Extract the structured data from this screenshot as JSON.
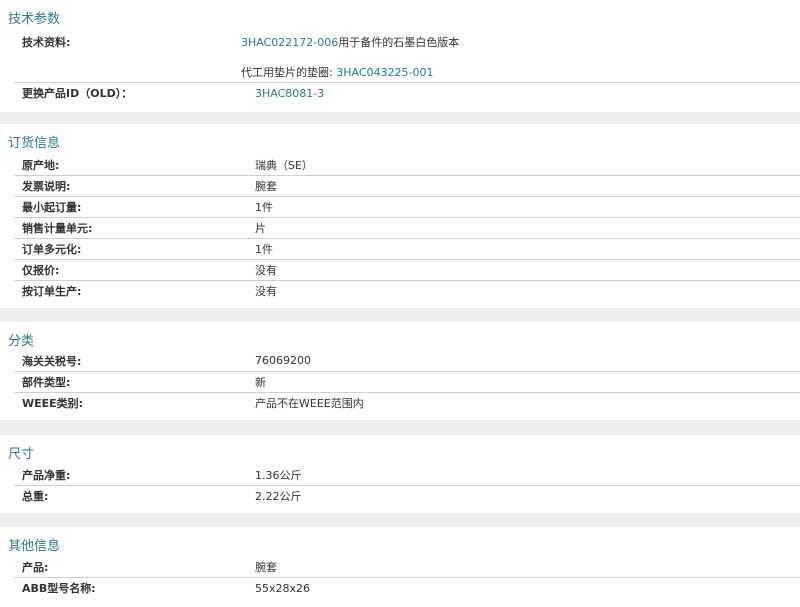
{
  "tech": {
    "title": "技术参数",
    "rows": [
      {
        "label": "技术资料:",
        "link": "3HAC022172-006",
        "text": "用于备件的石墨白色版本",
        "line2_prefix": "代工用垫片的垫圈:",
        "line2_link": "3HAC043225-001"
      },
      {
        "label": "更换产品ID（OLD）：",
        "link": "3HAC8081-3"
      }
    ]
  },
  "order": {
    "title": "订货信息",
    "rows": [
      {
        "label": "原产地:",
        "value": "瑞典（SE）"
      },
      {
        "label": "发票说明:",
        "value": "腕套"
      },
      {
        "label": "最小起订量:",
        "value": "1件"
      },
      {
        "label": "销售计量单元:",
        "value": "片"
      },
      {
        "label": "订单多元化:",
        "value": "1件"
      },
      {
        "label": "仅报价:",
        "value": "没有"
      },
      {
        "label": "按订单生产:",
        "value": "没有"
      }
    ]
  },
  "classification": {
    "title": "分类",
    "rows": [
      {
        "label": "海关关税号:",
        "value": "76069200"
      },
      {
        "label": "部件类型:",
        "value": "新"
      },
      {
        "label": "WEEE类别:",
        "value": "产品不在WEEE范围内"
      }
    ]
  },
  "dimensions": {
    "title": "尺寸",
    "rows": [
      {
        "label": "产品净重:",
        "value": "1.36公斤"
      },
      {
        "label": "总重:",
        "value": "2.22公斤"
      }
    ]
  },
  "other": {
    "title": "其他信息",
    "rows": [
      {
        "label": "产品:",
        "value": "腕套"
      },
      {
        "label": "ABB型号名称:",
        "value": "55x28x26"
      }
    ]
  }
}
